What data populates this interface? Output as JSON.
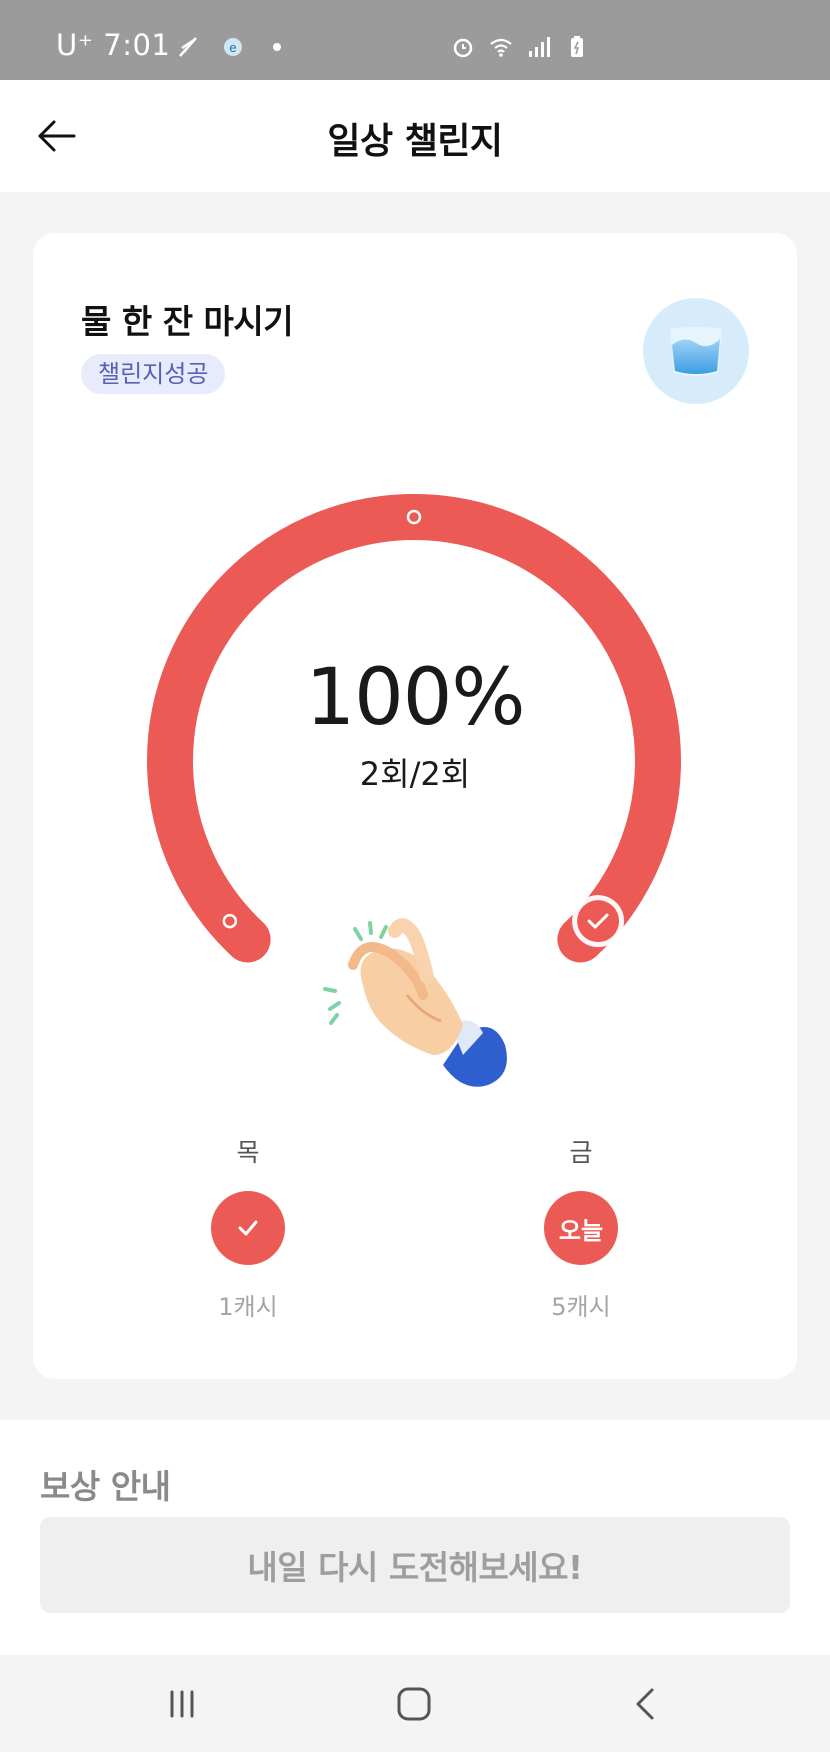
{
  "status_bar": {
    "carrier": "U⁺ 7:01",
    "icons_left": [
      "feather-icon",
      "app-notification-icon",
      "dot-icon"
    ],
    "icons_right": [
      "alarm-icon",
      "wifi-icon",
      "signal-icon",
      "battery-icon"
    ]
  },
  "header": {
    "title": "일상 챌린지",
    "back_icon": "arrow-left-icon"
  },
  "challenge": {
    "title": "물 한 잔 마시기",
    "badge": "챌린지성공",
    "icon": "water-glass-icon",
    "progress_percent_value": 100,
    "progress_percent": "100%",
    "progress_count": "2회/2회",
    "celebration_icon": "clapping-hands-icon",
    "days": [
      {
        "label": "목",
        "status": "done",
        "reward": "1캐시"
      },
      {
        "label": "금",
        "status": "today",
        "today_label": "오늘",
        "reward": "5캐시"
      }
    ]
  },
  "reward_info": {
    "heading": "보상 안내",
    "message": "내일 다시 도전해보세요!"
  },
  "nav": {
    "buttons": [
      "recent-apps-icon",
      "home-icon",
      "back-icon"
    ]
  },
  "colors": {
    "accent": "#eb5a55",
    "badge_bg": "#e7ebfb",
    "badge_text": "#5861b8",
    "status_bar": "#9b9b9b"
  }
}
